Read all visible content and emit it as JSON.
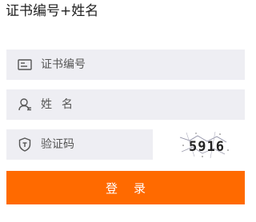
{
  "form": {
    "title": "证书编号+姓名",
    "cert_field": {
      "placeholder": "证书编号",
      "value": "",
      "icon": "id-card-icon"
    },
    "name_field": {
      "placeholder": "姓名",
      "value": "",
      "icon": "user-icon"
    },
    "code_field": {
      "placeholder": "验证码",
      "value": "",
      "icon": "shield-icon"
    },
    "captcha_text": "5916",
    "login_label": "登录"
  },
  "colors": {
    "accent": "#ff6a00",
    "field_bg": "#eeeef3",
    "text": "#222222"
  }
}
